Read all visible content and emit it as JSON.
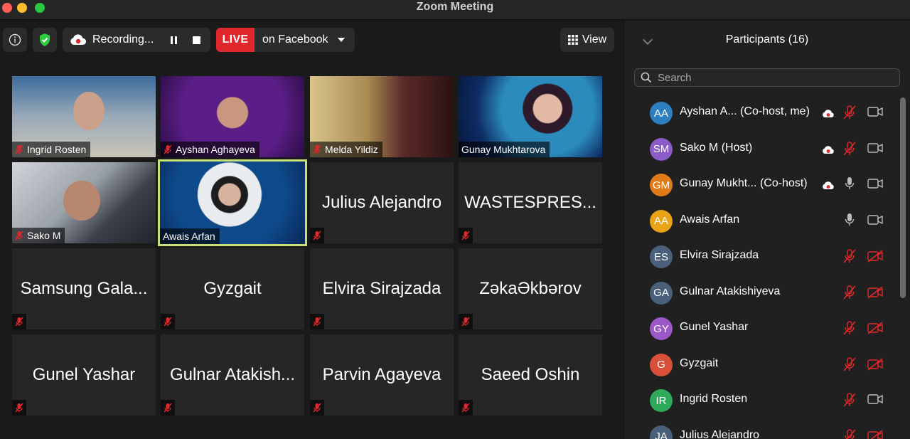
{
  "window": {
    "title": "Zoom Meeting"
  },
  "toolbar": {
    "recording_label": "Recording...",
    "live_badge": "LIVE",
    "live_target": "on Facebook",
    "view_label": "View"
  },
  "grid": {
    "tiles": [
      {
        "name": "Ingrid Rosten",
        "type": "video"
      },
      {
        "name": "Ayshan Aghayeva",
        "type": "video"
      },
      {
        "name": "Melda Yildiz",
        "type": "video"
      },
      {
        "name": "Gunay Mukhtarova",
        "type": "video"
      },
      {
        "name": "Sako M",
        "type": "video"
      },
      {
        "name": "Awais Arfan",
        "type": "video"
      },
      {
        "name": "Julius Alejandro",
        "type": "name"
      },
      {
        "name": "WASTESPRES...",
        "type": "name"
      },
      {
        "name": "Samsung Gala...",
        "type": "name"
      },
      {
        "name": "Gyzgait",
        "type": "name"
      },
      {
        "name": "Elvira Sirajzada",
        "type": "name"
      },
      {
        "name": "ZəkaƏkbərov",
        "type": "name"
      },
      {
        "name": "Gunel Yashar",
        "type": "name"
      },
      {
        "name": "Gulnar Atakish...",
        "type": "name"
      },
      {
        "name": "Parvin Agayeva",
        "type": "name"
      },
      {
        "name": "Saeed Oshin",
        "type": "name"
      }
    ]
  },
  "participants": {
    "title": "Participants (16)",
    "search_placeholder": "Search",
    "list": [
      {
        "initials": "AA",
        "name": "Ayshan A...  (Co-host, me)",
        "color": "#2e7fbf",
        "cloud": true,
        "mic": "muted",
        "cam": "on"
      },
      {
        "initials": "SM",
        "name": "Sako M (Host)",
        "color": "#8b5cc7",
        "cloud": true,
        "mic": "muted",
        "cam": "on"
      },
      {
        "initials": "GM",
        "name": "Gunay Mukht...  (Co-host)",
        "color": "#e07b1a",
        "cloud": true,
        "mic": "on",
        "cam": "on"
      },
      {
        "initials": "AA",
        "name": "Awais Arfan",
        "color": "#e8a317",
        "cloud": false,
        "mic": "on",
        "cam": "on"
      },
      {
        "initials": "ES",
        "name": "Elvira Sirajzada",
        "color": "#4a5f7a",
        "cloud": false,
        "mic": "muted",
        "cam": "off"
      },
      {
        "initials": "GA",
        "name": "Gulnar Atakishiyeva",
        "color": "#4a5f7a",
        "cloud": false,
        "mic": "muted",
        "cam": "off"
      },
      {
        "initials": "GY",
        "name": "Gunel Yashar",
        "color": "#9b59c7",
        "cloud": false,
        "mic": "muted",
        "cam": "off"
      },
      {
        "initials": "G",
        "name": "Gyzgait",
        "color": "#d9503a",
        "cloud": false,
        "mic": "muted",
        "cam": "off"
      },
      {
        "initials": "IR",
        "name": "Ingrid Rosten",
        "color": "#2eaa5a",
        "cloud": false,
        "mic": "muted",
        "cam": "on"
      },
      {
        "initials": "JA",
        "name": "Julius Alejandro",
        "color": "#4a5f7a",
        "cloud": false,
        "mic": "muted",
        "cam": "off"
      }
    ]
  }
}
